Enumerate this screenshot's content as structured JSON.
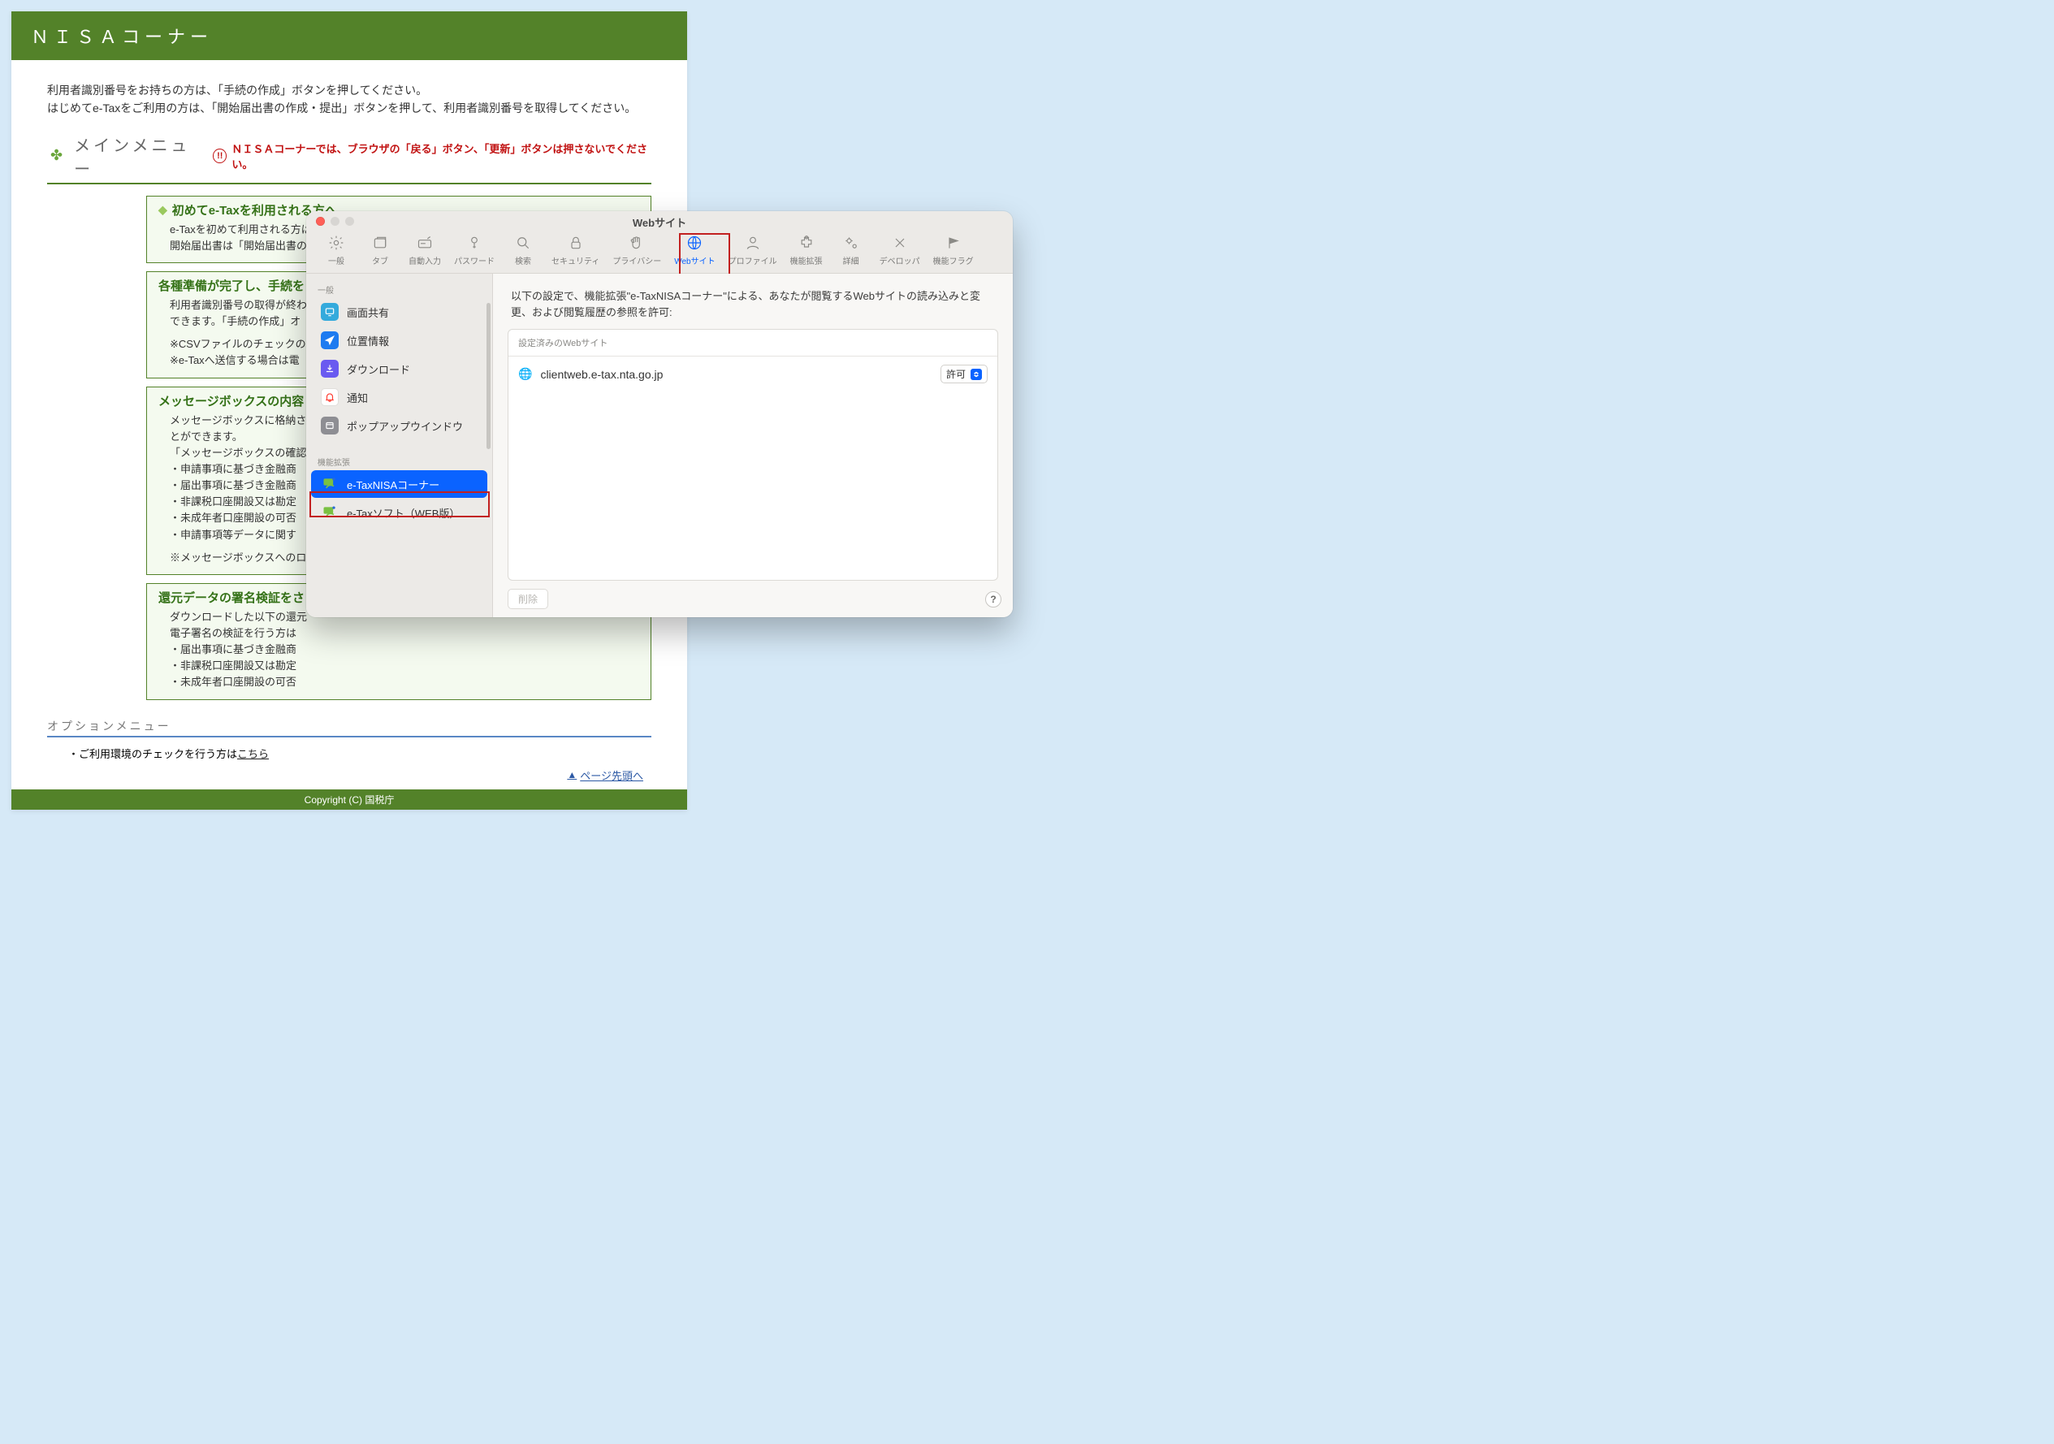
{
  "page": {
    "title": "ＮＩＳＡコーナー",
    "intro1": "利用者識別番号をお持ちの方は、「手続の作成」ボタンを押してください。",
    "intro2": "はじめてe-Taxをご利用の方は、「開始届出書の作成・提出」ボタンを押して、利用者識別番号を取得してください。",
    "menu_title": "メインメニュー",
    "warning": "ＮＩＳＡコーナーでは、ブラウザの「戻る」ボタン、「更新」ボタンは押さないでください。",
    "card1_title": "初めてe-Taxを利用される方へ",
    "card1_body": "e-Taxを初めて利用される方は、開始届出書を提出して利用者識別番号を取得する必要があります。開始届出書は「開始届出書の作成・提出」ボタンからオンラインで提出することができます。",
    "card2_title": "各種準備が完了し、手続を",
    "card2_l1": "利用者識別番号の取得が終わ",
    "card2_l2": "できます。「手続の作成」オ",
    "card2_l3": "※CSVファイルのチェックの",
    "card2_l4": "※e-Taxへ送信する場合は電",
    "card3_title": "メッセージボックスの内容",
    "card3_l1": "メッセージボックスに格納さ",
    "card3_l2": "とができます。",
    "card3_l3": "「メッセージボックスの確認",
    "card3_li1": "・申請事項に基づき金融商",
    "card3_li2": "・届出事項に基づき金融商",
    "card3_li3": "・非課税口座開設又は勘定",
    "card3_li4": "・未成年者口座開設の可否",
    "card3_li5": "・申請事項等データに関す",
    "card3_l4": "※メッセージボックスへのロ",
    "card4_title": "還元データの署名検証をさ",
    "card4_l1": "ダウンロードした以下の還元",
    "card4_l2": "電子署名の検証を行う方は",
    "card4_li1": "・届出事項に基づき金融商",
    "card4_li2": "・非課税口座開設又は勘定",
    "card4_li3": "・未成年者口座開設の可否",
    "option_title": "オプションメニュー",
    "option_text": "・ご利用環境のチェックを行う方は",
    "option_link": "こちら",
    "page_top": "ページ先頭へ",
    "copyright": "Copyright (C) 国税庁"
  },
  "win": {
    "title": "Webサイト",
    "toolbar": [
      {
        "id": "general",
        "label": "一般"
      },
      {
        "id": "tabs",
        "label": "タブ"
      },
      {
        "id": "autofill",
        "label": "自動入力"
      },
      {
        "id": "passwords",
        "label": "パスワード"
      },
      {
        "id": "search",
        "label": "検索"
      },
      {
        "id": "security",
        "label": "セキュリティ"
      },
      {
        "id": "privacy",
        "label": "プライバシー"
      },
      {
        "id": "websites",
        "label": "Webサイト"
      },
      {
        "id": "profiles",
        "label": "プロファイル"
      },
      {
        "id": "extensions",
        "label": "機能拡張"
      },
      {
        "id": "advanced",
        "label": "詳細"
      },
      {
        "id": "developer",
        "label": "デベロッパ"
      },
      {
        "id": "featureflags",
        "label": "機能フラグ"
      }
    ],
    "sidebar": {
      "section1": "一般",
      "items1": [
        {
          "id": "screenshare",
          "label": "画面共有",
          "color": "#34aadc"
        },
        {
          "id": "location",
          "label": "位置情報",
          "color": "#1e7bf0"
        },
        {
          "id": "downloads",
          "label": "ダウンロード",
          "color": "#6a5af0"
        },
        {
          "id": "notifications",
          "label": "通知",
          "color": "#ff3b30"
        },
        {
          "id": "popup",
          "label": "ポップアップウインドウ",
          "color": "#8e8e93"
        }
      ],
      "section2": "機能拡張",
      "items2": [
        {
          "id": "etax-nisa",
          "label": "e-TaxNISAコーナー"
        },
        {
          "id": "etax-web",
          "label": "e-Taxソフト（WEB版）"
        }
      ]
    },
    "desc": "以下の設定で、機能拡張\"e-TaxNISAコーナー\"による、あなたが閲覧するWebサイトの読み込みと変更、および閲覧履歴の参照を許可:",
    "configured_label": "設定済みのWebサイト",
    "site": "clientweb.e-tax.nta.go.jp",
    "permit": "許可",
    "delete": "削除",
    "help": "?"
  }
}
